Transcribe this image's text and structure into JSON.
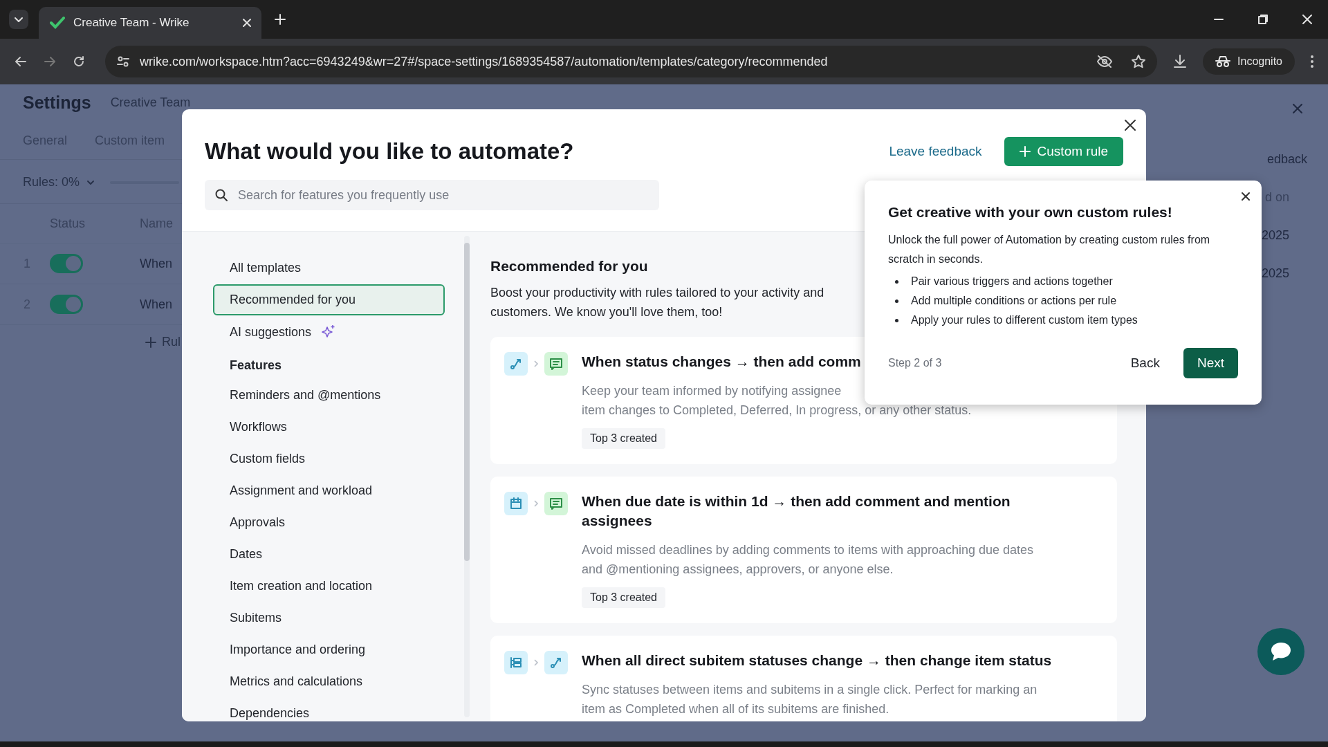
{
  "browser": {
    "tabs": [
      {
        "title": "Creative Team - Wrike",
        "selected": true
      }
    ],
    "url": "wrike.com/workspace.htm?acc=6943249&wr=27#/space-settings/1689354587/automation/templates/category/recommended",
    "incognito_label": "Incognito"
  },
  "background": {
    "title": "Settings",
    "space": "Creative Team",
    "tabs": [
      "General",
      "Custom item"
    ],
    "rules_label": "Rules: 0%",
    "columns": [
      "Status",
      "Name"
    ],
    "rows": [
      {
        "number": "1",
        "on": true,
        "name": "When"
      },
      {
        "number": "2",
        "on": true,
        "name": "When"
      }
    ],
    "add_label": "Rul",
    "right_header": "edback",
    "right_column": "d on",
    "right_dates": [
      "2025",
      "2025"
    ]
  },
  "modal": {
    "title": "What would you like to automate?",
    "search": {
      "placeholder": "Search for features you frequently use"
    },
    "leave_feedback": "Leave feedback",
    "custom_rule": "Custom rule",
    "nav": [
      {
        "kind": "item",
        "label": "All templates",
        "selected": false
      },
      {
        "kind": "item",
        "label": "Recommended for you",
        "selected": true
      },
      {
        "kind": "ai",
        "label": "AI suggestions",
        "selected": false
      },
      {
        "kind": "heading",
        "label": "Features"
      },
      {
        "kind": "item",
        "label": "Reminders and @mentions",
        "selected": false
      },
      {
        "kind": "item",
        "label": "Workflows",
        "selected": false
      },
      {
        "kind": "item",
        "label": "Custom fields",
        "selected": false
      },
      {
        "kind": "item",
        "label": "Assignment and workload",
        "selected": false
      },
      {
        "kind": "item",
        "label": "Approvals",
        "selected": false
      },
      {
        "kind": "item",
        "label": "Dates",
        "selected": false
      },
      {
        "kind": "item",
        "label": "Item creation and location",
        "selected": false
      },
      {
        "kind": "item",
        "label": "Subitems",
        "selected": false
      },
      {
        "kind": "item",
        "label": "Importance and ordering",
        "selected": false
      },
      {
        "kind": "item",
        "label": "Metrics and calculations",
        "selected": false
      },
      {
        "kind": "item",
        "label": "Dependencies",
        "selected": false
      }
    ],
    "section_title": "Recommended for you",
    "section_lines": [
      "Boost your productivity with rules tailored to your activity and",
      "customers. We know you'll love them, too!"
    ],
    "cards": [
      {
        "icons": [
          {
            "kind": "status"
          },
          {
            "kind": "comment"
          }
        ],
        "title": "When status changes → then add comm",
        "description_lines": [
          "Keep your team informed by notifying assignee",
          "item changes to Completed, Deferred, In progress, or any other status."
        ],
        "tag": "Top 3 created"
      },
      {
        "icons": [
          {
            "kind": "date"
          },
          {
            "kind": "comment"
          }
        ],
        "title": "When due date is within 1d → then add comment and mention assignees",
        "description_lines": [
          "Avoid missed deadlines by adding comments to items with approaching due dates",
          "and @mentioning assignees, approvers, or anyone else."
        ],
        "tag": "Top 3 created"
      },
      {
        "icons": [
          {
            "kind": "subitems"
          },
          {
            "kind": "status"
          }
        ],
        "title": "When all direct subitem statuses change → then change item status",
        "description_lines": [
          "Sync statuses between items and subitems in a single click. Perfect for marking an",
          "item as Completed when all of its subitems are finished."
        ]
      }
    ]
  },
  "popover": {
    "title": "Get creative with your own custom rules!",
    "intro": "Unlock the full power of Automation by creating custom rules from scratch in seconds.",
    "bullets": [
      "Pair various triggers and actions together",
      "Add multiple conditions or actions per rule",
      "Apply your rules to different custom item types"
    ],
    "step": "Step 2 of 3",
    "back": "Back",
    "next": "Next"
  }
}
